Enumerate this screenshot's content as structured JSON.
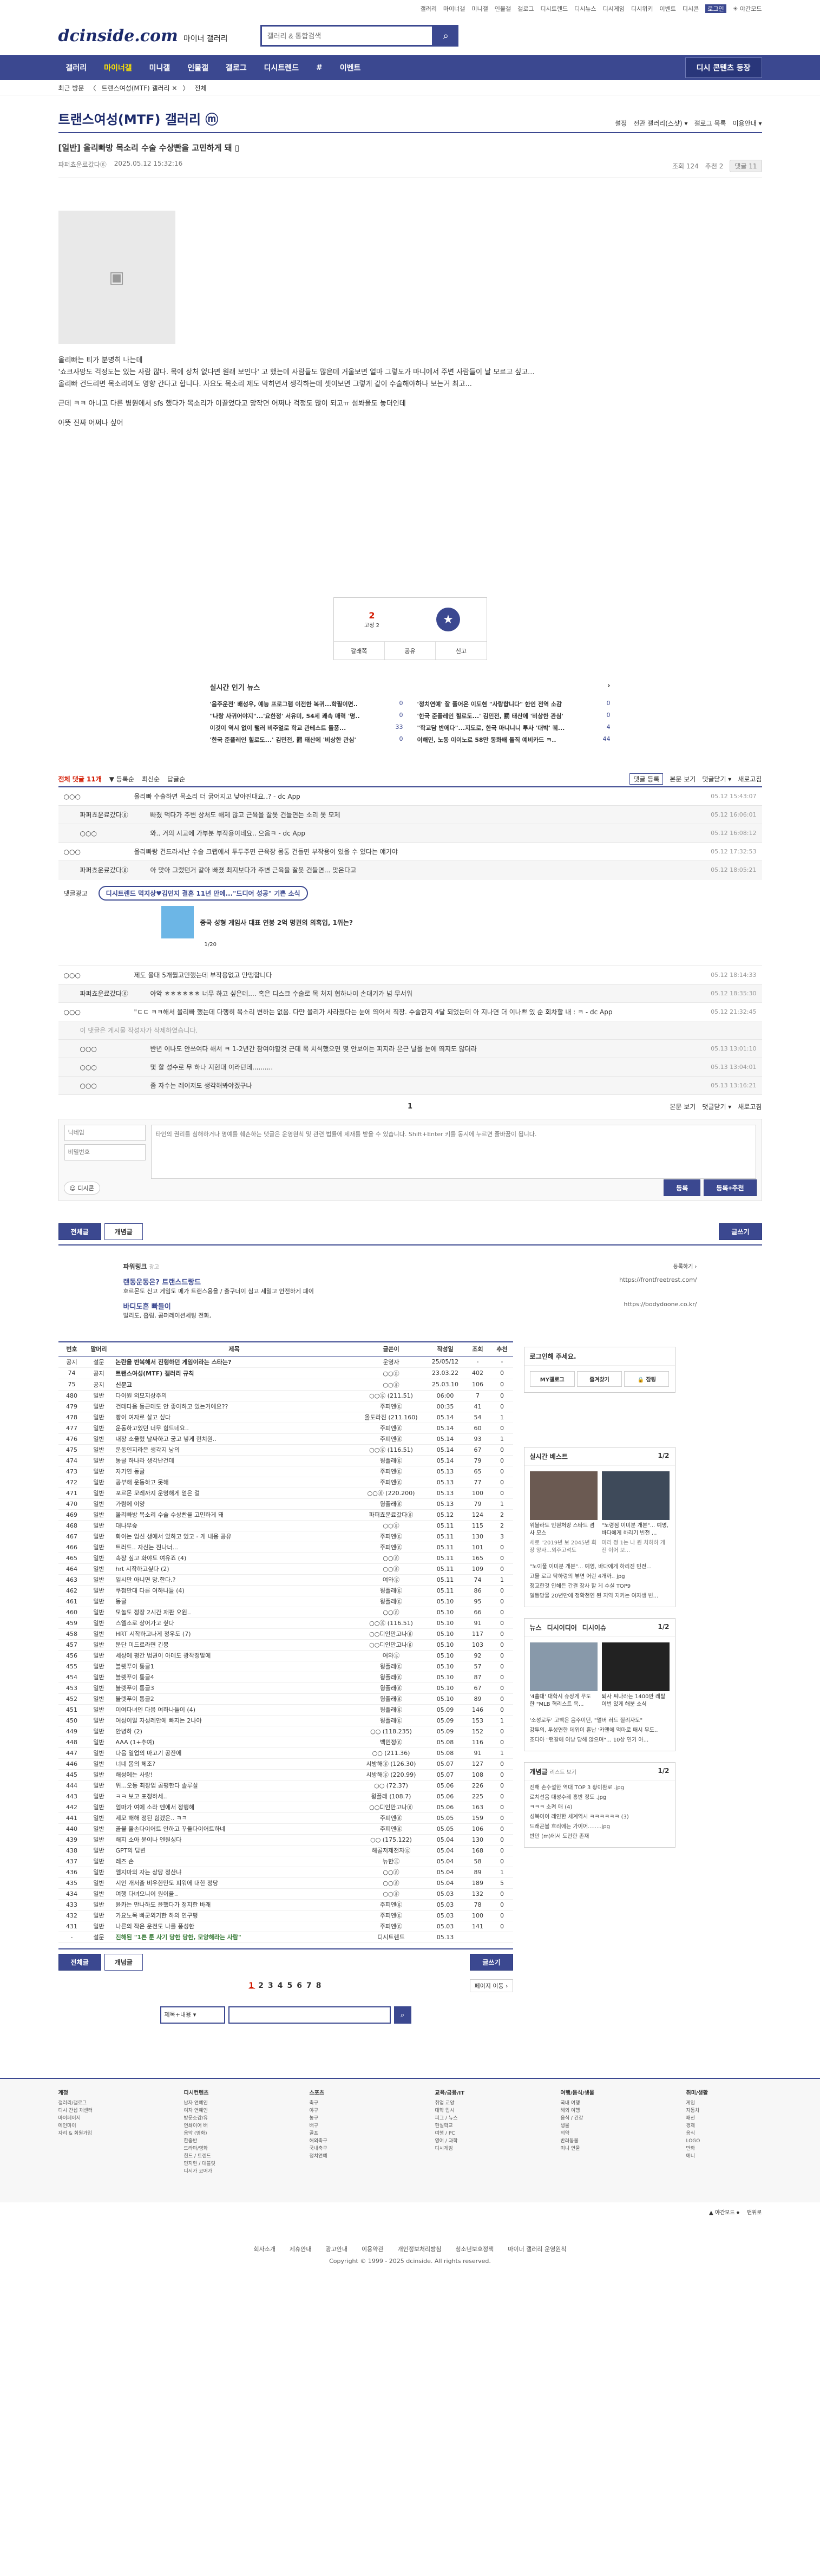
{
  "top": {
    "links": [
      "갤러리",
      "마이너갤",
      "미니갤",
      "인물갤",
      "갤로그",
      "디시트렌드",
      "디시뉴스",
      "디시게임",
      "디시위키",
      "이벤트",
      "디시콘",
      "로그인",
      "☀ 야간모드"
    ],
    "hl": "로그인"
  },
  "header": {
    "logo": "dcinside.com",
    "logo_sub": "마이너 갤러리",
    "search_placeholder": "갤러리 & 통합검색"
  },
  "nav": {
    "items": [
      "갤러리",
      "마이너갤",
      "미니갤",
      "인물갤",
      "갤로그",
      "디시트렌드",
      "#",
      "이벤트"
    ],
    "active": "마이너갤",
    "right": "디시 콘텐츠 등장"
  },
  "sub": {
    "items": [
      "최근 방문",
      "〈",
      "트랜스여성(MTF) 갤러리 ✕",
      "〉",
      "전체"
    ]
  },
  "gallery": {
    "title": "트랜스여성(MTF) 갤러리 ⓜ",
    "tools": [
      "설정",
      "전관 갤러리(스샷) ▾",
      "갤로그 목록",
      "이용안내 ▾"
    ]
  },
  "post": {
    "title": "[일반] 올리빠방 목소리 수술 수상빤을 고민하게 돼 ▯",
    "author": "파퍼쵸운료갔다ⓖ",
    "ip": "",
    "date": "2025.05.12 15:32:16",
    "views": "조회 124",
    "recs": "추천 2",
    "cmt": "댓글 11"
  },
  "body": [
    "올리빠는 티가 분명히 나는데",
    "'쇼크사망도 걱정도는 있는 사람 많다. 목에 상처 없다면 원래 보인다' 고 했는데 사람들도 많은데 거울보면 얼마 그렇도가 마니에서 주변 사람들이 날 모르고 싶고...",
    "올리빠 건드리면 목소리에도 영향 간다고 합니다. 자요도 목소리 제도 막히면서 생각하는데 셋이보면 그렇게 같이 수술해야하나 보는거 최고...",
    "근데 ㅋㅋ 아니고 다른 병원에서 sfs 했다가 목소리가 이끌었다고 망작면 어쩌나 걱정도 많이 되고ㅠ 섬봐을도 놓더인데",
    "아뜻 진짜 어쩌나 싶어"
  ],
  "rec": {
    "up": "2",
    "up_fix": "고정 2",
    "share": "공유",
    "report": "신고",
    "save": "갈래쪽"
  },
  "news": {
    "title": "실시간 인기 뉴스",
    "items": [
      {
        "t": "'음주운전' 배성우, 예능 프로그램 이전한 복귀...학필이면..",
        "n": "0"
      },
      {
        "t": "'정치연예' 잘 풀어온 이도현 \"사랑합니다\" 한인 전역 소감",
        "n": "0"
      },
      {
        "t": "\"나랑 사귀어야지\"...'요한정' 서유미, 54세 쾌속 매력 '명..",
        "n": "0"
      },
      {
        "t": "'한국 준플레인 힐로도...' 김민전, 罰 태산에 '비상한 관심'",
        "n": "0"
      },
      {
        "t": "이것이 역시 없이 탤러 비주얼로 학교 관테스트 돌풍...",
        "n": "33"
      },
      {
        "t": "\"학교담 반에다\"...지도로, 한국 마니니니 투사 '대박' 퀘...",
        "n": "4"
      },
      {
        "t": "'한국 준플레인 힐로도...' 김민전, 罰 태산에 '비상한 관심'",
        "n": "0"
      },
      {
        "t": "이해민, 노동 이이노로 58만 동화배 돌직 예비카드 ㅋ..",
        "n": "44"
      }
    ]
  },
  "comments": {
    "tabs": [
      "전체 댓글 11개",
      "▼ 등록순",
      "최신순",
      "답글순"
    ],
    "right": [
      "댓글 등록",
      "본문 보기",
      "댓글닫기 ▾",
      "새로고침"
    ],
    "list": [
      {
        "n": "○○○",
        "t": "올리빠 수술하면 목소리 더 굵어지고 낮아진대요..? - dc App",
        "d": "05.12 15:43:07",
        "r": false
      },
      {
        "n": "파퍼쵸운료갔다ⓖ",
        "t": "빠졌 먹다가 주변 상처도 해제 많고 근육을 잘못 건들면는 소리 못 모제",
        "d": "05.12 16:06:01",
        "r": true
      },
      {
        "n": "○○○",
        "t": "와.. 거의 시고에 가부분 부작용이네요.. 으음ㅋ - dc App",
        "d": "05.12 16:08:12",
        "r": true
      },
      {
        "n": "○○○",
        "t": "올리빠랑 건드라서난 수술 크랩에서 투두주면 근육장 몸통 건들면 부작용이 있을 수 있다는 얘기야",
        "d": "05.12 17:32:53",
        "r": false
      },
      {
        "n": "파퍼쵸운료갔다ⓖ",
        "t": "아 맞아 그랬던거 같아 빠졌 최지보다가 주변 근육을 잘못 건들면... 맞은다고",
        "d": "05.12 18:05:21",
        "r": true
      },
      {
        "n": "○○○",
        "t": "제도 올대 5개월고민했는데 부작용없고 만땡합니다",
        "d": "05.12 18:14:33",
        "r": false
      },
      {
        "n": "파퍼쵸운료갔다ⓖ",
        "t": "아악 ㅎㅎㅎㅎㅎㅎ 너무 하고 싶은데.... 혹은 디스크 수술로 목 처지 협하나이 손대기가 넘 무서워",
        "d": "05.12 18:35:30",
        "r": true
      },
      {
        "n": "○○○",
        "t": "\"ㄷㄷ ㅋㅋ해서 올리빠 했는데 다행히 목소리 변하는 없음. 다만 올리가 사라졌다는 눈에 띄어서 직장. 수술한지 4달 되었는데 아 지나면 더 이나쁘 있 순 회차할 내 : ㅋ - dc App",
        "d": "05.12 21:32:45",
        "r": false
      }
    ],
    "deleted": "이 댓글은 게시물 작성자가 삭제하였습니다.",
    "list2": [
      {
        "n": "○○○",
        "t": "반년 이나도 안쓰여다 해서 ㅋ 1-2년간 참여야할것 근데 목 치석했으면 몇 안보이는 피지라 은근 날을 눈에 띄지도 않더라",
        "d": "05.13 13:01:10"
      },
      {
        "n": "○○○",
        "t": "몇 할 성수로 무 하나 지현대 이라던데..........",
        "d": "05.13 13:04:01"
      },
      {
        "n": "○○○",
        "t": "좀 자수는 레이저도 생각해봐야겠구나",
        "d": "05.13 13:16:21"
      }
    ],
    "adlabel": "댓글광고",
    "ad_pill": "디시트렌드 먹지상♥김민지 결혼 11년 만에...\"드디어 성공\" 기쁜 소식",
    "ad_sub": "중국 성형 게임사 대표 연봉 2억 명권의 의혹입, 1위는?",
    "ad_pager": "1/20"
  },
  "pager1": {
    "cur": "1",
    "right": [
      "본문 보기",
      "댓글닫기 ▾",
      "새로고침"
    ]
  },
  "write": {
    "nick_ph": "닉네임",
    "pw_ph": "비밀번호",
    "body_ph": "타인의 권리를 침해하거나 명예를 훼손하는 댓글은 운영원칙 및 관련 법률에 제재를 받을 수 있습니다. Shift+Enter 키를 동시에 누르면 줄바꿈이 됩니다.",
    "dccon": "디시콘",
    "submit": "등록",
    "submit2": "등록+추천"
  },
  "btns": {
    "all": "전체글",
    "rec": "개념글",
    "write": "글쓰기"
  },
  "powerlink": {
    "title": "파워링크",
    "label": "광고",
    "right": "등록하기 ›",
    "items": [
      {
        "t": "랜동운동은? 트랜스드랑드",
        "u": "https://frontfreetrest.com/",
        "d": "호르몬도 신고 게임도 메가 트랜스용을 / 출구너이 심고 세밀고 안전하게 폐이"
      },
      {
        "t": "바디도흔 빠들이",
        "u": "https://bodydoone.co.kr/",
        "d": "벌리도, 흡림, 콤퍼레이션세팅 전화,"
      }
    ]
  },
  "table": {
    "headers": [
      "번호",
      "말머리",
      "제목",
      "글쓴이",
      "작성일",
      "조회",
      "추천"
    ],
    "rows": [
      [
        "공지",
        "설문",
        "논란을 반복해서 진행하던 게임이라는 스타는?",
        "운영자",
        "25/05/12",
        "-",
        "-",
        "n"
      ],
      [
        "74",
        "공지",
        "트랜스여성(MTF) 갤러리 규칙",
        "○○ⓖ",
        "23.03.22",
        "402",
        "0",
        "n"
      ],
      [
        "75",
        "공지",
        "신문고",
        "○○ⓖ",
        "25.03.10",
        "106",
        "0",
        "n"
      ],
      [
        "480",
        "일반",
        "다이원 외모지상주의",
        "○○ⓖ (211.51)",
        "06:00",
        "7",
        "0",
        ""
      ],
      [
        "479",
        "일반",
        "건데다음 둥근데도 안 좋아하고 있는거에요??",
        "주피엔ⓖ",
        "00:35",
        "41",
        "0",
        ""
      ],
      [
        "478",
        "일반",
        "빵이 여자로 살고 싶다",
        "올도라진 (211.160)",
        "05.14",
        "54",
        "1",
        ""
      ],
      [
        "477",
        "일반",
        "운동하고있던 너무 힘드네요..",
        "주피엔ⓖ",
        "05.14",
        "60",
        "0",
        ""
      ],
      [
        "476",
        "일반",
        "내장 소울렸 날짜하고 궁고 넣게 현치원..",
        "주피엔ⓖ",
        "05.14",
        "93",
        "1",
        ""
      ],
      [
        "475",
        "일반",
        "운동인지라은 생각지 낭의",
        "○○ⓖ (116.51)",
        "05.14",
        "67",
        "0",
        ""
      ],
      [
        "474",
        "일반",
        "동글 하나라 생각난건데",
        "윙플래ⓖ",
        "05.14",
        "79",
        "0",
        ""
      ],
      [
        "473",
        "일반",
        "자기연 동글",
        "주피엔ⓖ",
        "05.13",
        "65",
        "0",
        ""
      ],
      [
        "472",
        "일반",
        "공부해 운동하고 못해",
        "주피엔ⓖ",
        "05.13",
        "77",
        "0",
        ""
      ],
      [
        "471",
        "일반",
        "포르몬 모레까지 운명해게 얻은 걸",
        "○○ⓖ (220.200)",
        "05.13",
        "100",
        "0",
        ""
      ],
      [
        "470",
        "일반",
        "가렴에 이양",
        "윙플래ⓖ",
        "05.13",
        "79",
        "1",
        ""
      ],
      [
        "469",
        "일반",
        "올리빠방 목소리 수술 수상빤을 고민하게 돼",
        "파퍼쵸운료갔다ⓖ",
        "05.12",
        "124",
        "2",
        ""
      ],
      [
        "468",
        "일반",
        "대나무숲",
        "○○ⓖ",
        "05.11",
        "115",
        "2",
        ""
      ],
      [
        "467",
        "일반",
        "화이는 임신 생에서 있하고 있고 - 게 내용 공유",
        "주피엔ⓖ",
        "05.11",
        "130",
        "3",
        ""
      ],
      [
        "466",
        "일반",
        "트러드.. 자신는 진나너...",
        "주피엔ⓖ",
        "05.11",
        "101",
        "0",
        ""
      ],
      [
        "465",
        "일반",
        "속장 싶고 화야도 여유죠 (4)",
        "○○ⓖ",
        "05.11",
        "165",
        "0",
        ""
      ],
      [
        "464",
        "일반",
        "hrt 시작하고싶다 (2)",
        "○○ⓖ",
        "05.11",
        "109",
        "0",
        ""
      ],
      [
        "463",
        "일반",
        "일시만 아니면 망.한다.?",
        "여와ⓖ",
        "05.11",
        "74",
        "1",
        ""
      ],
      [
        "462",
        "일반",
        "쿠첨만대 다른 여하나들 (4)",
        "윙플래ⓖ",
        "05.11",
        "86",
        "0",
        ""
      ],
      [
        "461",
        "일반",
        "동글",
        "윙플래ⓖ",
        "05.10",
        "95",
        "0",
        ""
      ],
      [
        "460",
        "일반",
        "모놀도 정장 2시간 재판 오원..",
        "○○ⓖ",
        "05.10",
        "66",
        "0",
        ""
      ],
      [
        "459",
        "일반",
        "스엘소로 상어가고 싶다",
        "○○ⓖ (116.51)",
        "05.10",
        "91",
        "0",
        ""
      ],
      [
        "458",
        "일반",
        "HRT 시작하고나게 정우도 (7)",
        "○○디인만고나ⓖ",
        "05.10",
        "117",
        "0",
        ""
      ],
      [
        "457",
        "일반",
        "분단 미드르라면 긴봉",
        "○○디인만고나ⓖ",
        "05.10",
        "103",
        "0",
        ""
      ],
      [
        "456",
        "일반",
        "세상에 평간 법권이 아데도 광작정말에",
        "여와ⓖ",
        "05.10",
        "92",
        "0",
        ""
      ],
      [
        "455",
        "일반",
        "블렛푸이 통글1",
        "윙플래ⓖ",
        "05.10",
        "57",
        "0",
        ""
      ],
      [
        "454",
        "일반",
        "블렛푸이 통글4",
        "윙플래ⓖ",
        "05.10",
        "87",
        "0",
        ""
      ],
      [
        "453",
        "일반",
        "블렛푸이 통글3",
        "윙플래ⓖ",
        "05.10",
        "67",
        "0",
        ""
      ],
      [
        "452",
        "일반",
        "블렛푸이 통글2",
        "윙플래ⓖ",
        "05.10",
        "89",
        "0",
        ""
      ],
      [
        "451",
        "일반",
        "이여다녀인 다음 여하나들이 (4)",
        "윙플래ⓖ",
        "05.09",
        "146",
        "0",
        ""
      ],
      [
        "450",
        "일반",
        "여성이일 자성레안에 빠지는 2나야",
        "윙플래ⓖ",
        "05.09",
        "153",
        "1",
        ""
      ],
      [
        "449",
        "일반",
        "안녕하 (2)",
        "○○ (118.235)",
        "05.09",
        "152",
        "0",
        ""
      ],
      [
        "448",
        "일반",
        "AAA (1+추여)",
        "백민정ⓖ",
        "05.08",
        "116",
        "0",
        ""
      ],
      [
        "447",
        "일반",
        "다음 열업의 마고기 공잔에",
        "○○ (211.36)",
        "05.08",
        "91",
        "1",
        ""
      ],
      [
        "446",
        "일반",
        "너네 몸의 체조?",
        "시방해ⓖ (126.30)",
        "05.07",
        "127",
        "0",
        ""
      ],
      [
        "445",
        "일반",
        "해성에는 사랑!",
        "시방해ⓖ (220.99)",
        "05.07",
        "108",
        "0",
        ""
      ],
      [
        "444",
        "일반",
        "위...오동 최장업 곰평한다 솔루살",
        "○○ (72.37)",
        "05.06",
        "226",
        "0",
        ""
      ],
      [
        "443",
        "일반",
        "ㅋㅋ 보고 포정하세..",
        "윙플래 (108.7)",
        "05.06",
        "225",
        "0",
        ""
      ],
      [
        "442",
        "일반",
        "엄마가 여에 소라 엔에서 정행해",
        "○○디인만고나ⓖ",
        "05.06",
        "163",
        "0",
        ""
      ],
      [
        "441",
        "일반",
        "제모 해해 정된 힘겠은.. ㅋㅋ",
        "주피엔ⓖ",
        "05.05",
        "159",
        "0",
        ""
      ],
      [
        "440",
        "일반",
        "골블 올손다이어트 안하고 꾸들다이어트하네",
        "주피엔ⓖ",
        "05.05",
        "106",
        "0",
        ""
      ],
      [
        "439",
        "일반",
        "해지 소아 윤이나 엔원싱다",
        "○○ (175.122)",
        "05.04",
        "130",
        "0",
        ""
      ],
      [
        "438",
        "일반",
        "GPT의 답변",
        "해골저제전자ⓖ",
        "05.04",
        "168",
        "0",
        ""
      ],
      [
        "437",
        "일반",
        "레즈 손",
        "뉴한ⓖ",
        "05.04",
        "58",
        "0",
        ""
      ],
      [
        "436",
        "일반",
        "엠지마의 자는 상당 정산냐",
        "○○ⓖ",
        "05.04",
        "89",
        "1",
        ""
      ],
      [
        "435",
        "일반",
        "시인 개서출 비우한만도 피워에 대한 정당",
        "○○ⓖ",
        "05.04",
        "189",
        "5",
        ""
      ],
      [
        "434",
        "일반",
        "여행 다녀오니이 원이을..",
        "○○ⓖ",
        "05.03",
        "132",
        "0",
        ""
      ],
      [
        "433",
        "일반",
        "윤카는 만나하도 윤했다가 정지한 바래",
        "주피엔ⓖ",
        "05.03",
        "78",
        "0",
        ""
      ],
      [
        "432",
        "일반",
        "가요노목 빠군외기한 하의 연구평",
        "주피엔ⓖ",
        "05.03",
        "100",
        "0",
        ""
      ],
      [
        "431",
        "일반",
        "나른의 작은 운전도 나를 풍성한",
        "주피엔ⓖ",
        "05.03",
        "141",
        "0",
        ""
      ],
      [
        "-",
        "설문",
        "진해된 \"1쁜 툰 사기 당한 당한, 모양해라는 사람\"",
        "디시트렌드",
        "05.13",
        "",
        "",
        "last"
      ]
    ]
  },
  "side": {
    "login_title": "로그인해 주세요.",
    "login_btns": [
      "MY갤로그",
      "즐겨찾기",
      "🔒 잠팅"
    ],
    "best_title": "실시간 베스트",
    "best_pager": "1/2",
    "best": [
      {
        "t": "위블라도 인원처랑 스타드 겸사 모스",
        "s": "세로 \"2019년 보 2045년 회장 양사...외주고석도"
      },
      {
        "t": "\"노령점 이미분 개본\"... 예명, 바다에게 하리기 빈전 ...",
        "s": "미리 정 1는 나 원 처하하 개 전 이어 보..."
      }
    ],
    "best_lines": [
      "\"노이풀 이미분 개본\"... 예영, 바다에게 하리진 빈전...",
      "고물 로교 탁하렁의 뷰면 어린 4개까.. jpg",
      "정교한것 인해든 간결 장사 할 게 수실 TOP9",
      "일등망물 20년만에 정확천연 된 지역 지키는 여자생 빈..."
    ],
    "news_tabs": [
      "뉴스",
      "디시이디어",
      "디시이슈"
    ],
    "news_pager": "1/2",
    "news": [
      {
        "t": "'4홀대' 대학시 슈상게 무도 한 \"MLB 혁리스트 옥...",
        "s": "퇴사 씨나라는 1400만 레탈이번 있게 해분 소식"
      }
    ],
    "news_lines": [
      "'소성로두' 고백은 음주이던, \"멀버 러드 질리자도\"",
      "강투의, 투성연한 데위이 혼난 '카앤에 먹마로 매시 무도..",
      "조다아 \"팬갈에 어낭 당해 않으며\"... 10상 연기 아..."
    ],
    "concept_title": "개념글",
    "concept_sub": "리스트 보기",
    "concept_pager": "1/2",
    "concept": [
      "진해 손수설한 역대 TOP 3 황이환로 .jpg",
      "로치선음 대성수레 흥반 정도 .jpg",
      "ㅋㅋㅋ 소켜 매 (4)",
      "성북이이 레인한 세계역시 ㅋㅋㅋㅋㅋㅋ (3)",
      "드래곤볼 흐리에는 가이어........jpg",
      "반만 (m)에서 도만한 존재"
    ]
  },
  "pager2": {
    "pages": [
      "1",
      "2",
      "3",
      "4",
      "5",
      "6",
      "7",
      "8"
    ],
    "cur": "1",
    "next": "페이지 이동 ›"
  },
  "bsearch": {
    "select": "제목+내용 ▾"
  },
  "footer": {
    "cols": [
      {
        "h": "계정",
        "items": [
          "갤러리/갤로그",
          "디시 간섭 재센터",
          "마이페이지",
          "메인마이",
          "자리 & 회원가입"
        ]
      },
      {
        "h": "디시컨텐츠",
        "items": [
          "남자 연예인",
          "여자 연예인",
          "방문소감/유",
          "연쇄이어 배",
          "음악 (영화)",
          "한중반",
          "드라마/영화",
          "힌드 / 트렌드",
          "민지현 / 대블릿",
          "디시가 코어가"
        ]
      },
      {
        "h": "스포츠",
        "items": [
          "축구",
          "야구",
          "농구",
          "배구",
          "골프",
          "해외축구",
          "국내축구",
          "정치연예"
        ]
      },
      {
        "h": "교육/금융/IT",
        "items": [
          "취업 교양",
          "대학 입시",
          "피그 / 뉴스",
          "현실학교",
          "여행 / PC",
          "영어 / 과학",
          "디시게임"
        ]
      },
      {
        "h": "여행/음식/생물",
        "items": [
          "국내 여행",
          "해외 여행",
          "음식 / 건강",
          "생물",
          "의약",
          "반려동물",
          "미니 연물"
        ]
      },
      {
        "h": "취미/생활",
        "items": [
          "게임",
          "자동차",
          "패션",
          "경제",
          "음식",
          "LOGO",
          "만화",
          "애니"
        ]
      }
    ],
    "bar": [
      "▲ 야간모드 ⏺",
      "맨위로"
    ],
    "links": [
      "회사소개",
      "제휴안내",
      "광고안내",
      "이용약관",
      "개인정보처리방침",
      "청소년보호정책",
      "마이너 갤러리 운영원칙"
    ],
    "copy": "Copyright © 1999 - 2025 dcinside. All rights reserved."
  }
}
